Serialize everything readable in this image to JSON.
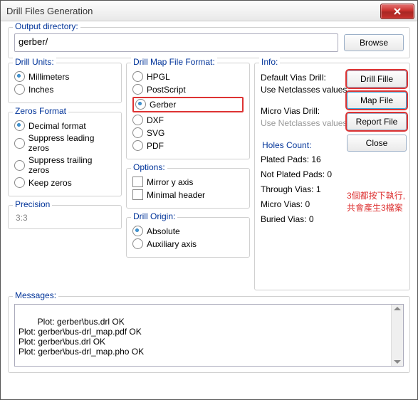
{
  "title": "Drill Files Generation",
  "output": {
    "legend": "Output directory:",
    "value": "gerber/",
    "browse": "Browse"
  },
  "drillUnits": {
    "legend": "Drill Units:",
    "mm": "Millimeters",
    "in": "Inches"
  },
  "zeros": {
    "legend": "Zeros Format",
    "decimal": "Decimal format",
    "supLead": "Suppress leading zeros",
    "supTrail": "Suppress trailing zeros",
    "keep": "Keep zeros"
  },
  "precision": {
    "legend": "Precision",
    "value": "3:3"
  },
  "mapFmt": {
    "legend": "Drill Map File Format:",
    "hpgl": "HPGL",
    "ps": "PostScript",
    "gerber": "Gerber",
    "dxf": "DXF",
    "svg": "SVG",
    "pdf": "PDF"
  },
  "options": {
    "legend": "Options:",
    "mirror": "Mirror y axis",
    "minhdr": "Minimal header"
  },
  "origin": {
    "legend": "Drill Origin:",
    "abs": "Absolute",
    "aux": "Auxiliary axis"
  },
  "info": {
    "legend": "Info:",
    "dvd": "Default Vias Drill:",
    "use1": "Use Netclasses values",
    "mvd": "Micro Vias Drill:",
    "use2": "Use Netclasses values",
    "holesLegend": "Holes Count:",
    "h1": "Plated Pads: 16",
    "h2": "Not Plated Pads: 0",
    "h3": "Through Vias: 1",
    "h4": "Micro Vias: 0",
    "h5": "Buried Vias: 0"
  },
  "buttons": {
    "drill": "Drill Fille",
    "map": "Map File",
    "report": "Report File",
    "close": "Close"
  },
  "annot": {
    "l1": "3個都按下執行,",
    "l2": "共會產生3檔案"
  },
  "messages": {
    "legend": "Messages:",
    "text": "Plot: gerber\\bus.drl OK\nPlot: gerber\\bus-drl_map.pdf OK\nPlot: gerber\\bus.drl OK\nPlot: gerber\\bus-drl_map.pho OK"
  }
}
